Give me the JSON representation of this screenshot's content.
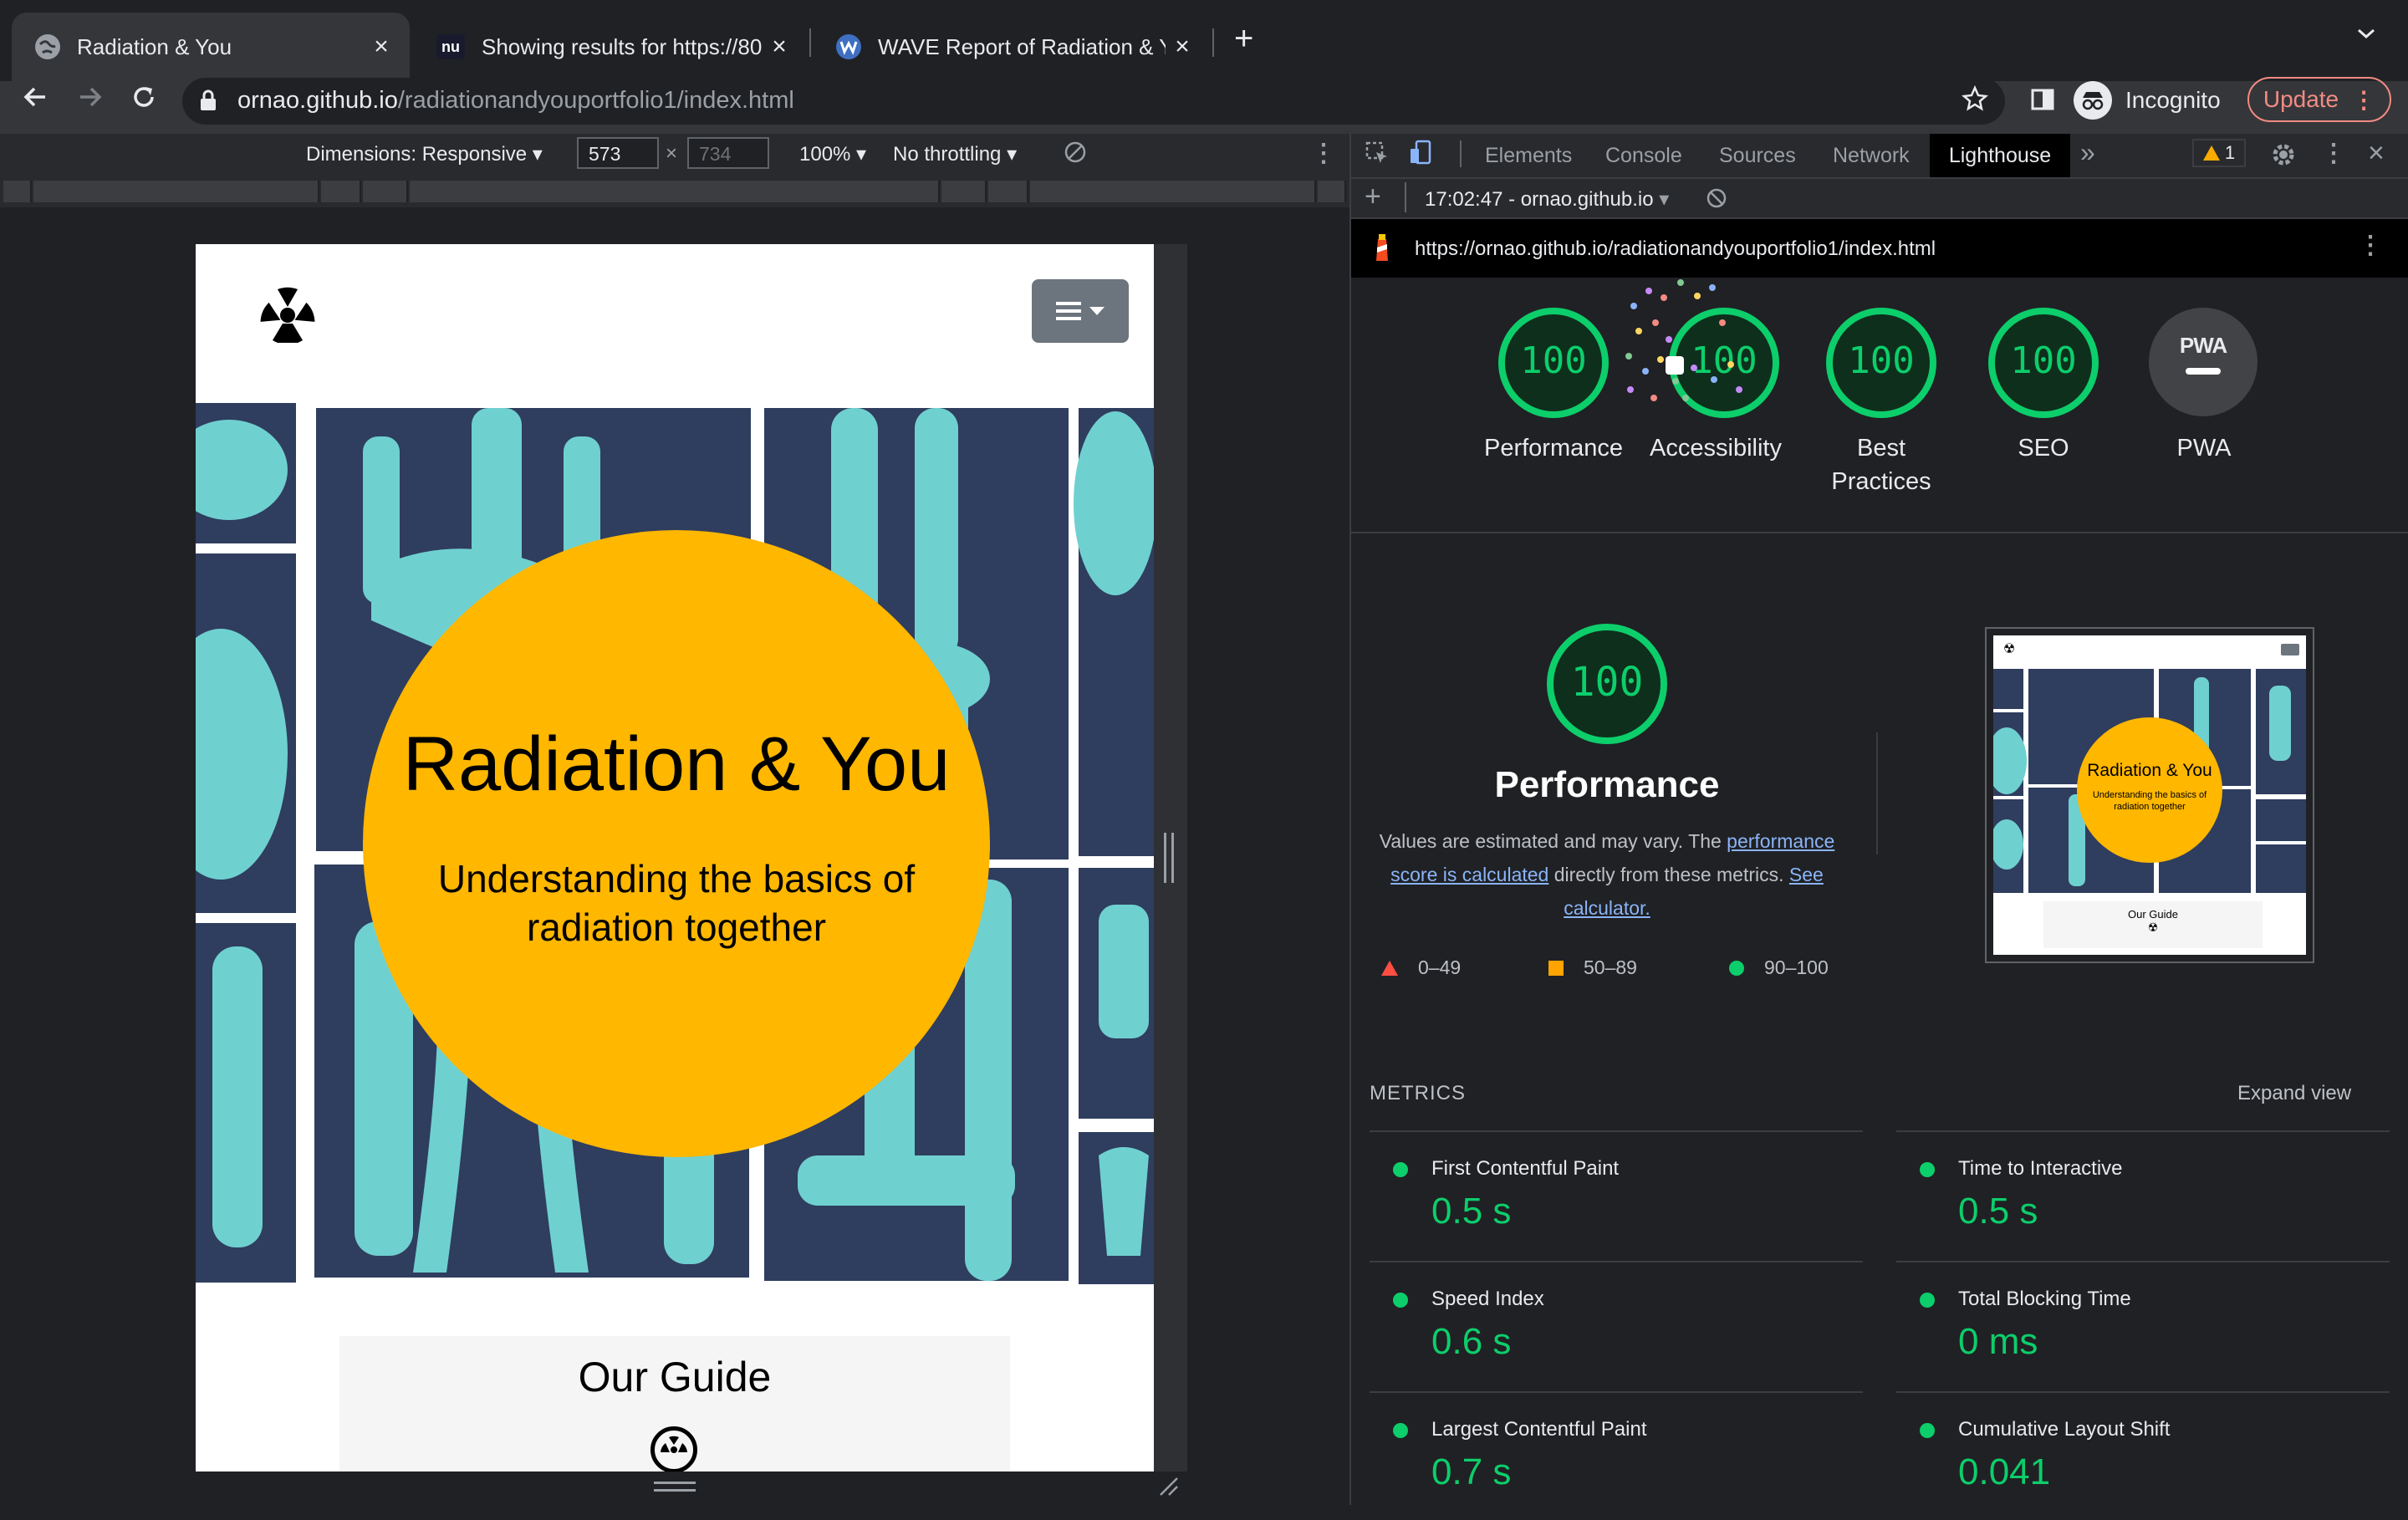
{
  "browser": {
    "tabs": [
      {
        "title": "Radiation & You",
        "active": true
      },
      {
        "title": "Showing results for https://800",
        "active": false
      },
      {
        "title": "WAVE Report of Radiation & Yo",
        "active": false
      }
    ],
    "new_tab_icon": "plus-icon",
    "url_host": "ornao.github.io",
    "url_path": "/radiationandyouportfolio1/index.html",
    "profile_label": "Incognito",
    "update_label": "Update"
  },
  "device_toolbar": {
    "dimensions_label": "Dimensions: Responsive",
    "width_value": "573",
    "height_placeholder": "734",
    "times": "×",
    "zoom_label": "100%",
    "throttle_label": "No throttling"
  },
  "site": {
    "hero_title": "Radiation & You",
    "hero_subtitle_line1": "Understanding the basics of",
    "hero_subtitle_line2": "radiation together",
    "guide_title": "Our Guide",
    "accent_color": "#ffb700"
  },
  "devtools": {
    "tabs": [
      "Elements",
      "Console",
      "Sources",
      "Network",
      "Lighthouse"
    ],
    "active_tab": "Lighthouse",
    "more_tabs": "»",
    "warning_count": "1",
    "report_label": "17:02:47 - ornao.github.io",
    "report_url": "https://ornao.github.io/radiationandyouportfolio1/index.html",
    "scores": [
      {
        "label": "Performance",
        "value": "100"
      },
      {
        "label": "Accessibility",
        "value": "100"
      },
      {
        "label": "Best Practices",
        "label_line1": "Best",
        "label_line2": "Practices",
        "value": "100"
      },
      {
        "label": "SEO",
        "value": "100"
      },
      {
        "label": "PWA",
        "value": "PWA"
      }
    ],
    "performance": {
      "score": "100",
      "title": "Performance",
      "desc_prefix": "Values are estimated and may vary. The ",
      "desc_link1_a": "performance",
      "desc_link1_b": "score is calculated",
      "desc_mid": " directly from these metrics. ",
      "desc_link2_a": "See",
      "desc_link2_b": "calculator.",
      "legend": [
        {
          "range": "0–49",
          "color": "#ff4e42"
        },
        {
          "range": "50–89",
          "color": "#ffa400"
        },
        {
          "range": "90–100",
          "color": "#0cce6b"
        }
      ],
      "thumb_title": "Radiation & You",
      "thumb_sub": "Understanding the basics of radiation together",
      "thumb_guide": "Our Guide"
    },
    "metrics_heading": "METRICS",
    "expand_label": "Expand view",
    "metrics": [
      {
        "name": "First Contentful Paint",
        "value": "0.5 s"
      },
      {
        "name": "Time to Interactive",
        "value": "0.5 s"
      },
      {
        "name": "Speed Index",
        "value": "0.6 s"
      },
      {
        "name": "Total Blocking Time",
        "value": "0 ms"
      },
      {
        "name": "Largest Contentful Paint",
        "value": "0.7 s"
      },
      {
        "name": "Cumulative Layout Shift",
        "value": "0.041"
      }
    ],
    "good_color": "#0cce6b"
  }
}
